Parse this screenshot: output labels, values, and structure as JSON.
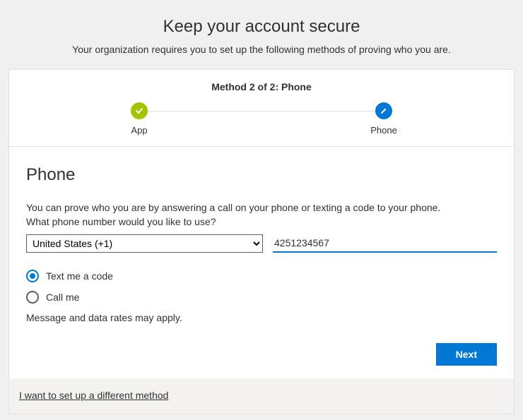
{
  "header": {
    "title": "Keep your account secure",
    "subtitle": "Your organization requires you to set up the following methods of proving who you are."
  },
  "wizard": {
    "method_label": "Method 2 of 2: Phone",
    "step_done_label": "App",
    "step_current_label": "Phone"
  },
  "form": {
    "section_title": "Phone",
    "desc1": "You can prove who you are by answering a call on your phone or texting a code to your phone.",
    "desc2": "What phone number would you like to use?",
    "country_value": "United States (+1)",
    "phone_value": "4251234567",
    "radio_text": "Text me a code",
    "radio_call": "Call me",
    "rates": "Message and data rates may apply.",
    "next_button": "Next"
  },
  "footer": {
    "different_method": "I want to set up a different method"
  }
}
